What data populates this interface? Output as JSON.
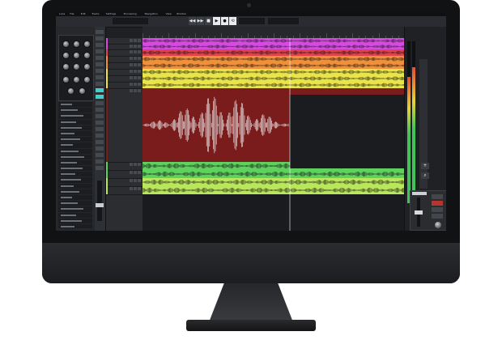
{
  "app": {
    "menu": [
      "Luna",
      "File",
      "Edit",
      "Tracks",
      "Settings",
      "Processing",
      "Navigation",
      "View",
      "Window"
    ]
  },
  "transport": {
    "buttons": [
      {
        "name": "rewind-icon",
        "glyph": "◀◀"
      },
      {
        "name": "fast-forward-icon",
        "glyph": "▶▶"
      },
      {
        "name": "stop-icon",
        "glyph": "■"
      },
      {
        "name": "play-icon",
        "glyph": "▶"
      },
      {
        "name": "record-icon",
        "glyph": "●"
      },
      {
        "name": "loop-icon",
        "glyph": "⟲"
      }
    ]
  },
  "inspector": {
    "buttons": [
      {
        "name": "add-icon",
        "glyph": "+"
      },
      {
        "name": "zoom-icon",
        "glyph": "⌕"
      }
    ]
  },
  "colors": {
    "magenta": "#d54be0",
    "red": "#e2424b",
    "orange": "#f0903a",
    "yellow": "#e9e44a",
    "dark_red": "#5a1616",
    "green": "#5fd15f",
    "lime": "#b9e65a",
    "accent_blue": "#4fb4ea",
    "accent_cyan": "#3fd0c8"
  },
  "tracks": [
    {
      "color": "#d54be0"
    },
    {
      "color": "#d54be0"
    },
    {
      "color": "#e2424b"
    },
    {
      "color": "#f0903a"
    },
    {
      "color": "#f0903a"
    },
    {
      "color": "#e9e44a"
    },
    {
      "color": "#e9e44a"
    },
    {
      "color": "#e9e44a"
    },
    {
      "color": "#7a1c1c"
    },
    {
      "color": "#5fd15f"
    },
    {
      "color": "#5fd15f"
    },
    {
      "color": "#b9e65a"
    },
    {
      "color": "#b9e65a"
    }
  ],
  "meters": {
    "left_level": 0.78,
    "right_level": 0.84
  }
}
